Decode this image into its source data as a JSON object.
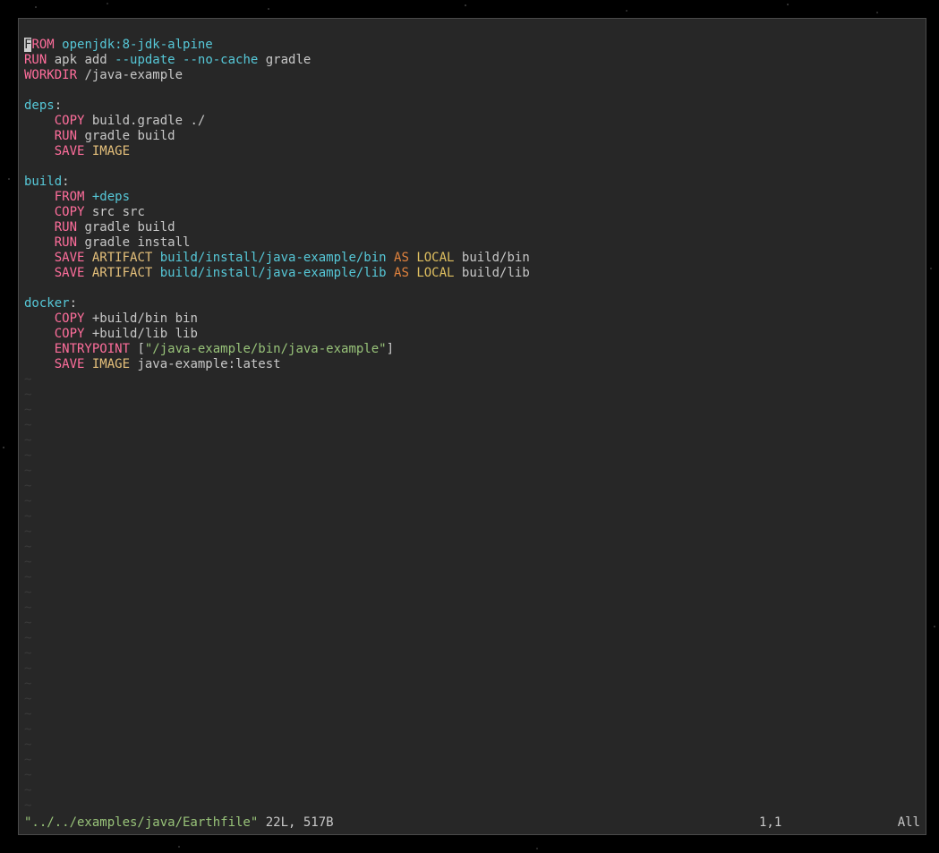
{
  "file": {
    "cursor_char": "F",
    "line1_rom": "ROM",
    "line1_image": " openjdk:8-jdk-alpine",
    "line2_run": "RUN",
    "line2_a": " apk add ",
    "line2_flag1": "--update",
    "line2_sp": " ",
    "line2_flag2": "--no-cache",
    "line2_b": " gradle",
    "line3_wd": "WORKDIR",
    "line3_path": " /java-example",
    "deps_label": "deps",
    "colon": ":",
    "indent": "    ",
    "copy": "COPY",
    "deps_copy_args": " build.gradle ./",
    "run": "RUN",
    "deps_run_args": " gradle build",
    "save": "SAVE",
    "image": " IMAGE",
    "build_label": "build",
    "from": "FROM",
    "build_from_ref": " +deps",
    "build_copy_args": " src src",
    "build_run1": " gradle build",
    "build_run2": " gradle install",
    "artifact": " ARTIFACT",
    "build_art1_path": " build/install/java-example/bin",
    "build_art2_path": " build/install/java-example/lib",
    "as": " AS",
    "local": " LOCAL",
    "build_art1_dest": " build/bin",
    "build_art2_dest": " build/lib",
    "docker_label": "docker",
    "docker_copy1": " +build/bin bin",
    "docker_copy2": " +build/lib lib",
    "entrypoint": "ENTRYPOINT",
    "ep_open": " [",
    "ep_str": "\"/java-example/bin/java-example\"",
    "ep_close": "]",
    "docker_save_tag": " java-example:latest"
  },
  "status": {
    "filename": "\"../../examples/java/Earthfile\"",
    "stats": " 22L, 517B",
    "cursor_pos": "1,1",
    "percent": "All"
  },
  "tilde": "~"
}
